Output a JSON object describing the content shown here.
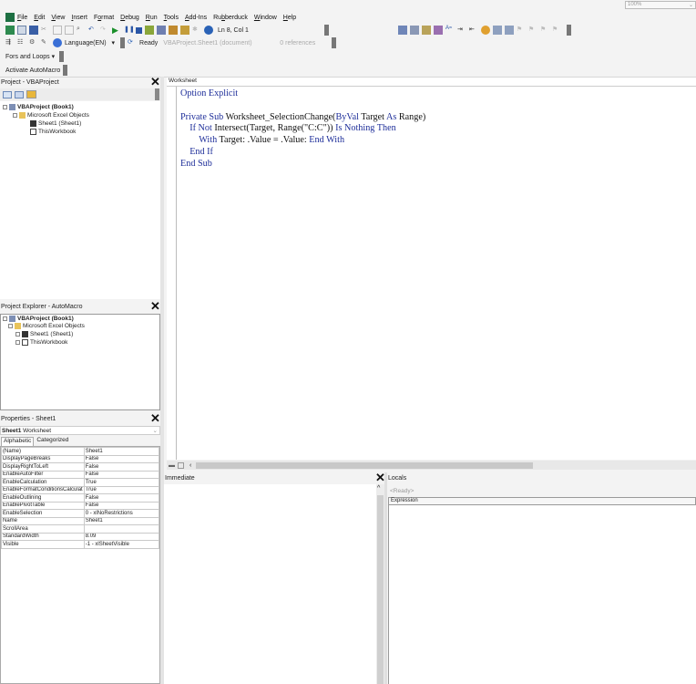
{
  "toolbar_top_right": {
    "zoom": "100%"
  },
  "menu": {
    "items": [
      {
        "label": "File",
        "u": "F"
      },
      {
        "label": "Edit",
        "u": "E"
      },
      {
        "label": "View",
        "u": "V"
      },
      {
        "label": "Insert",
        "u": "I"
      },
      {
        "label": "Format",
        "u": "o"
      },
      {
        "label": "Debug",
        "u": "D"
      },
      {
        "label": "Run",
        "u": "R"
      },
      {
        "label": "Tools",
        "u": "T"
      },
      {
        "label": "Add-Ins",
        "u": "A"
      },
      {
        "label": "Rubberduck",
        "u": "b"
      },
      {
        "label": "Window",
        "u": "W"
      },
      {
        "label": "Help",
        "u": "H"
      }
    ]
  },
  "standard_toolbar": {
    "position": "Ln 8, Col 1"
  },
  "rubberduck_toolbar": {
    "language": "Language(EN)",
    "status": "Ready",
    "selection": "VBAProject.Sheet1 (document)",
    "references": "0 references"
  },
  "fors_toolbar": {
    "label": "Fors and Loops"
  },
  "automacro_toolbar": {
    "label": "Activate AutoMacro"
  },
  "project_panel": {
    "title": "Project - VBAProject",
    "tree": [
      {
        "text": "VBAProject (Book1)",
        "bold": true
      },
      {
        "text": "Microsoft Excel Objects",
        "bold": false
      },
      {
        "text": "Sheet1 (Sheet1)",
        "bold": false
      },
      {
        "text": "ThisWorkbook",
        "bold": false
      }
    ]
  },
  "explorer_panel": {
    "title": "Project Explorer - AutoMacro",
    "tree": [
      {
        "text": "VBAProject (Book1)",
        "bold": true
      },
      {
        "text": "Microsoft Excel Objects",
        "bold": false
      },
      {
        "text": "Sheet1 (Sheet1)",
        "bold": false
      },
      {
        "text": "ThisWorkbook",
        "bold": false
      }
    ]
  },
  "properties_panel": {
    "title": "Properties - Sheet1",
    "object_name": "Sheet1",
    "object_type": "Worksheet",
    "tabs": [
      "Alphabetic",
      "Categorized"
    ],
    "rows": [
      [
        "(Name)",
        "Sheet1"
      ],
      [
        "DisplayPageBreaks",
        "False"
      ],
      [
        "DisplayRightToLeft",
        "False"
      ],
      [
        "EnableAutoFilter",
        "False"
      ],
      [
        "EnableCalculation",
        "True"
      ],
      [
        "EnableFormatConditionsCalculat",
        "True"
      ],
      [
        "EnableOutlining",
        "False"
      ],
      [
        "EnablePivotTable",
        "False"
      ],
      [
        "EnableSelection",
        "0 - xlNoRestrictions"
      ],
      [
        "Name",
        "Sheet1"
      ],
      [
        "ScrollArea",
        ""
      ],
      [
        "StandardWidth",
        "8.09"
      ],
      [
        "Visible",
        "-1 - xlSheetVisible"
      ]
    ]
  },
  "code_window": {
    "object_combo": "Worksheet",
    "lines": [
      "Option Explicit",
      "",
      "Private Sub Worksheet_SelectionChange(ByVal Target As Range)",
      "    If Not Intersect(Target, Range(\"C:C\")) Is Nothing Then",
      "        With Target: .Value = .Value: End With",
      "    End If",
      "End Sub"
    ]
  },
  "immediate_panel": {
    "title": "Immediate"
  },
  "locals_panel": {
    "title": "Locals",
    "status": "<Ready>",
    "column": "Expression"
  }
}
